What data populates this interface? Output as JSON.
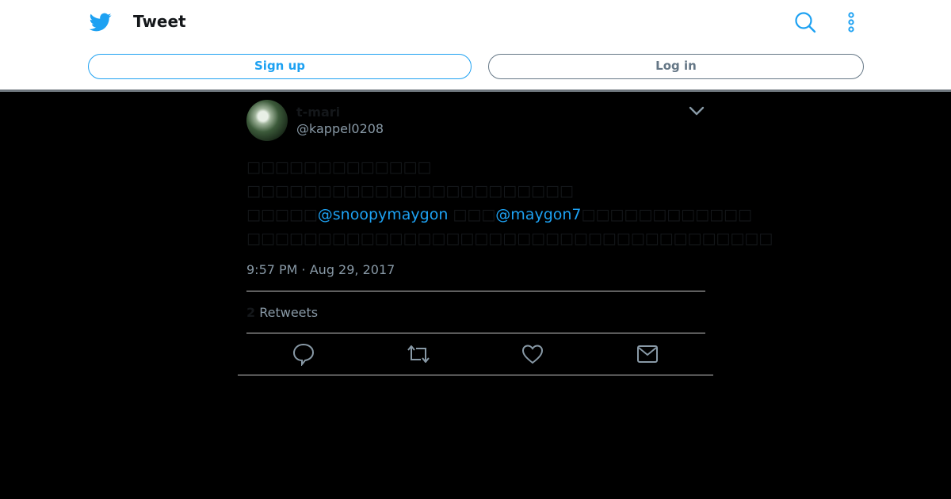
{
  "header": {
    "title": "Tweet",
    "signup_label": "Sign up",
    "login_label": "Log in"
  },
  "tweet": {
    "display_name": "t-mari",
    "handle": "@kappel0208",
    "lines": [
      "□□□□□□□□□□□□□",
      "□□□□□□□□□□□□□□□□□□□□□□□",
      "□□□□□",
      "□□□□□□□□□□□□□□□□□□□□□□□□□□□□□□□□□□□□□"
    ],
    "mention_1": "@snoopymaygon",
    "between_mentions": " □□□",
    "mention_2": "@maygon7",
    "after_mentions": "□□□□□□□□□□□□",
    "timestamp": "9:57 PM · Aug 29, 2017",
    "retweet_count": "2",
    "retweets_label": "Retweets"
  },
  "icons": {
    "logo": "twitter-bird-icon",
    "search": "search-icon",
    "more": "more-vertical-icon",
    "caret": "chevron-down-icon",
    "reply": "reply-icon",
    "retweet": "retweet-icon",
    "like": "heart-icon",
    "share": "mail-icon"
  },
  "colors": {
    "brand": "#1da1f2",
    "muted": "#8899a6",
    "page_bg": "#000000"
  }
}
